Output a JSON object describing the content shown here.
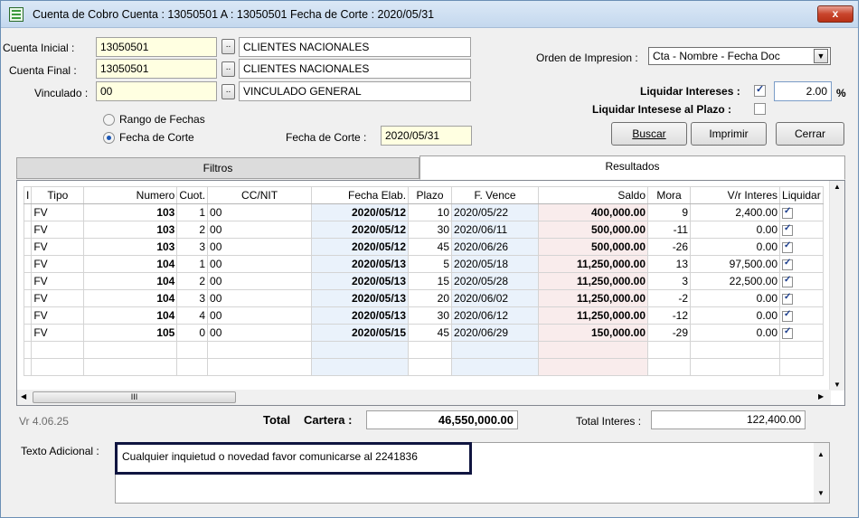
{
  "window": {
    "title": "Cuenta de Cobro   Cuenta : 13050501 A : 13050501   Fecha de Corte : 2020/05/31",
    "close_label": "x"
  },
  "filters": {
    "cuenta_inicial_label": "Cuenta Inicial :",
    "cuenta_inicial_value": "13050501",
    "cuenta_inicial_name": "CLIENTES NACIONALES",
    "cuenta_final_label": "Cuenta Final :",
    "cuenta_final_value": "13050501",
    "cuenta_final_name": "CLIENTES NACIONALES",
    "vinculado_label": "Vinculado :",
    "vinculado_value": "00",
    "vinculado_name": "VINCULADO GENERAL",
    "dots_label": "..",
    "rango_fechas_label": "Rango de Fechas",
    "fecha_corte_radio_label": "Fecha de Corte",
    "fecha_corte_label": "Fecha de Corte :",
    "fecha_corte_value": "2020/05/31"
  },
  "options": {
    "orden_label": "Orden de Impresion :",
    "orden_value": "Cta - Nombre - Fecha Doc",
    "liquidar_intereses_label": "Liquidar Intereses :",
    "liquidar_intereses_checked": true,
    "interes_value": "2.00",
    "percent_symbol": "%",
    "liquidar_plazo_label": "Liquidar Intesese al Plazo :",
    "liquidar_plazo_checked": false
  },
  "buttons": {
    "buscar": "Buscar",
    "imprimir": "Imprimir",
    "cerrar": "Cerrar"
  },
  "tabs": [
    "Filtros",
    "Resultados"
  ],
  "table": {
    "columns": [
      "I",
      "Tipo",
      "Numero",
      "Cuot.",
      "CC/NIT",
      "Fecha Elab.",
      "Plazo",
      "F. Vence",
      "Saldo",
      "Mora",
      "V/r Interes",
      "Liquidar"
    ],
    "rows": [
      {
        "tipo": "FV",
        "numero": "103",
        "cuota": "1",
        "ccnit": "00",
        "fecha": "2020/05/12",
        "plazo": "10",
        "vence": "2020/05/22",
        "saldo": "400,000.00",
        "mora": "9",
        "interes": "2,400.00",
        "liquidar": true
      },
      {
        "tipo": "FV",
        "numero": "103",
        "cuota": "2",
        "ccnit": "00",
        "fecha": "2020/05/12",
        "plazo": "30",
        "vence": "2020/06/11",
        "saldo": "500,000.00",
        "mora": "-11",
        "interes": "0.00",
        "liquidar": true
      },
      {
        "tipo": "FV",
        "numero": "103",
        "cuota": "3",
        "ccnit": "00",
        "fecha": "2020/05/12",
        "plazo": "45",
        "vence": "2020/06/26",
        "saldo": "500,000.00",
        "mora": "-26",
        "interes": "0.00",
        "liquidar": true
      },
      {
        "tipo": "FV",
        "numero": "104",
        "cuota": "1",
        "ccnit": "00",
        "fecha": "2020/05/13",
        "plazo": "5",
        "vence": "2020/05/18",
        "saldo": "11,250,000.00",
        "mora": "13",
        "interes": "97,500.00",
        "liquidar": true
      },
      {
        "tipo": "FV",
        "numero": "104",
        "cuota": "2",
        "ccnit": "00",
        "fecha": "2020/05/13",
        "plazo": "15",
        "vence": "2020/05/28",
        "saldo": "11,250,000.00",
        "mora": "3",
        "interes": "22,500.00",
        "liquidar": true
      },
      {
        "tipo": "FV",
        "numero": "104",
        "cuota": "3",
        "ccnit": "00",
        "fecha": "2020/05/13",
        "plazo": "20",
        "vence": "2020/06/02",
        "saldo": "11,250,000.00",
        "mora": "-2",
        "interes": "0.00",
        "liquidar": true
      },
      {
        "tipo": "FV",
        "numero": "104",
        "cuota": "4",
        "ccnit": "00",
        "fecha": "2020/05/13",
        "plazo": "30",
        "vence": "2020/06/12",
        "saldo": "11,250,000.00",
        "mora": "-12",
        "interes": "0.00",
        "liquidar": true
      },
      {
        "tipo": "FV",
        "numero": "105",
        "cuota": "0",
        "ccnit": "00",
        "fecha": "2020/05/15",
        "plazo": "45",
        "vence": "2020/06/29",
        "saldo": "150,000.00",
        "mora": "-29",
        "interes": "0.00",
        "liquidar": true
      }
    ],
    "empty_rows": 2,
    "scroll_thumb_label": "III"
  },
  "footer": {
    "version": "Vr 4.06.25",
    "total_label": "Total",
    "cartera_label": "Cartera :",
    "total_cartera": "46,550,000.00",
    "total_interes_label": "Total Interes :",
    "total_interes": "122,400.00"
  },
  "texto": {
    "label": "Texto Adicional :",
    "value": "Cualquier inquietud o novedad favor comunicarse al 2241836"
  }
}
